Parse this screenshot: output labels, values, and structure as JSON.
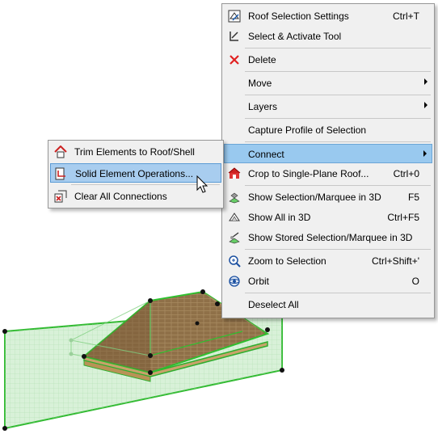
{
  "main_menu": {
    "items": [
      {
        "label": "Roof Selection Settings",
        "shortcut": "Ctrl+T",
        "icon": "roof-settings-icon"
      },
      {
        "label": "Select & Activate Tool",
        "shortcut": "",
        "icon": "select-tool-icon"
      },
      {
        "label": "Delete",
        "shortcut": "",
        "icon": "delete-icon"
      },
      {
        "label": "Move",
        "shortcut": "",
        "icon": ""
      },
      {
        "label": "Layers",
        "shortcut": "",
        "icon": ""
      },
      {
        "label": "Capture Profile of Selection",
        "shortcut": "",
        "icon": ""
      },
      {
        "label": "Connect",
        "shortcut": "",
        "icon": ""
      },
      {
        "label": "Crop to Single-Plane Roof...",
        "shortcut": "Ctrl+0",
        "icon": "crop-roof-icon"
      },
      {
        "label": "Show Selection/Marquee in 3D",
        "shortcut": "F5",
        "icon": "show-selection-3d-icon"
      },
      {
        "label": "Show All in 3D",
        "shortcut": "Ctrl+F5",
        "icon": "show-all-3d-icon"
      },
      {
        "label": "Show Stored Selection/Marquee in 3D",
        "shortcut": "",
        "icon": "show-stored-3d-icon"
      },
      {
        "label": "Zoom to Selection",
        "shortcut": "Ctrl+Shift+'",
        "icon": "zoom-selection-icon"
      },
      {
        "label": "Orbit",
        "shortcut": "O",
        "icon": "orbit-icon"
      },
      {
        "label": "Deselect All",
        "shortcut": "",
        "icon": ""
      }
    ]
  },
  "connect_submenu": {
    "items": [
      {
        "label": "Trim Elements to Roof/Shell",
        "icon": "trim-roof-icon"
      },
      {
        "label": "Solid Element Operations...",
        "icon": "solid-operations-icon"
      },
      {
        "label": "Clear All Connections",
        "icon": "clear-connections-icon"
      }
    ]
  },
  "colors": {
    "highlight": "#99c9ef",
    "menu_background": "#f0f0f0",
    "selection_green": "#22bb22",
    "roof_brown": "#9b7a4a"
  }
}
